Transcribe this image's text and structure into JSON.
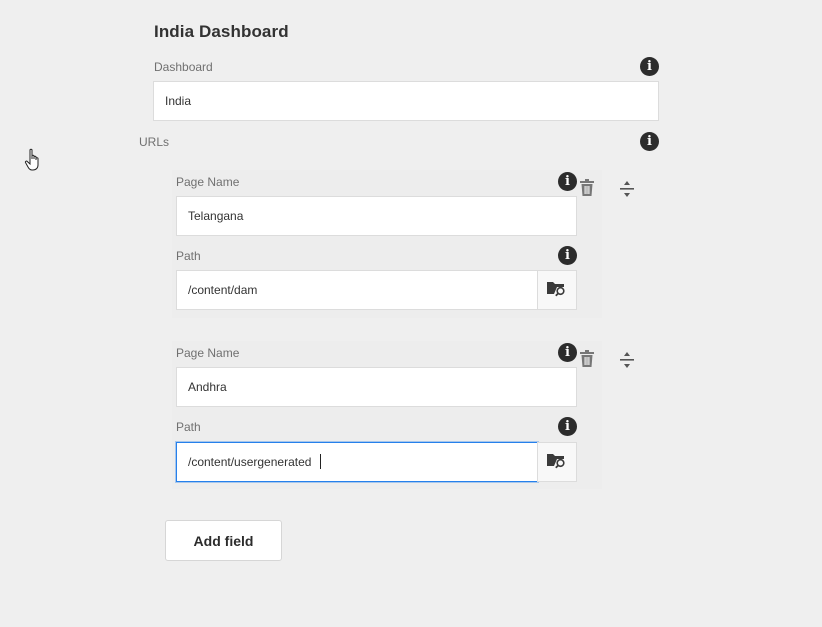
{
  "dialog": {
    "title": "India Dashboard",
    "dashboard_label": "Dashboard",
    "dashboard_value": "India",
    "urls_label": "URLs",
    "info_glyph": "i"
  },
  "urls": [
    {
      "page_name_label": "Page Name",
      "page_name_value": "Telangana",
      "path_label": "Path",
      "path_value": "/content/dam"
    },
    {
      "page_name_label": "Page Name",
      "page_name_value": "Andhra",
      "path_label": "Path",
      "path_value": "/content/usergenerated"
    }
  ],
  "add_field_label": "Add field",
  "icons": {
    "info": "info-icon",
    "trash": "trash-icon",
    "reorder": "reorder-icon",
    "browse": "folder-search-icon",
    "pointer": "hand-pointer-icon"
  },
  "colors": {
    "background": "#efefef",
    "focus": "#2680eb",
    "icon_dark": "#2c2c2c"
  }
}
